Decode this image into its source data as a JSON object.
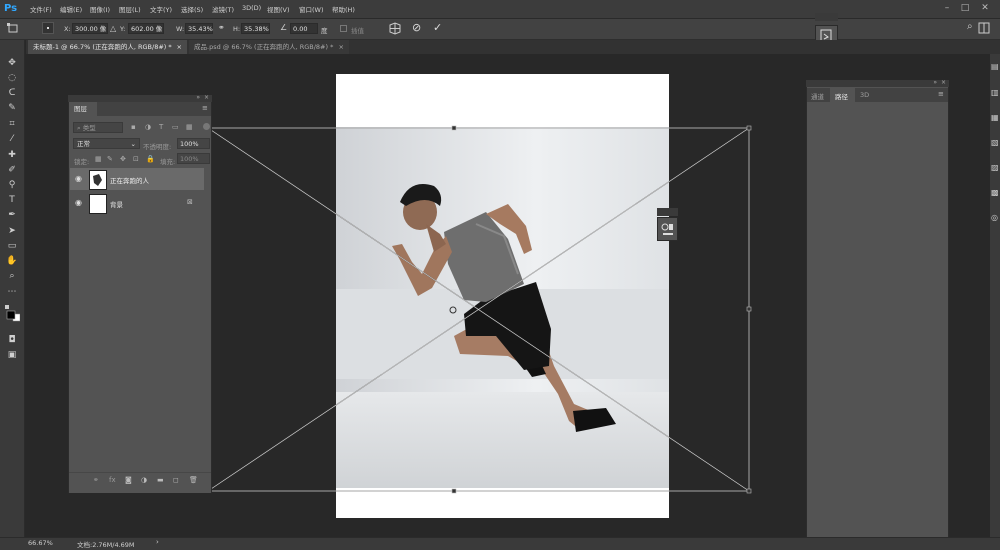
{
  "app": {
    "logo": "Ps"
  },
  "menu": [
    "文件(F)",
    "编辑(E)",
    "图像(I)",
    "图层(L)",
    "文字(Y)",
    "选择(S)",
    "滤镜(T)",
    "3D(D)",
    "视图(V)",
    "窗口(W)",
    "帮助(H)"
  ],
  "window_controls": {
    "minimize": "–",
    "maximize": "□",
    "close": "✕"
  },
  "options": {
    "x_label": "X:",
    "x_value": "300.00 像",
    "y_label": "Y:",
    "y_value": "602.00 像",
    "w_label": "W:",
    "w_value": "35.43%",
    "h_label": "H:",
    "h_value": "35.38%",
    "angle_value": "0.00",
    "angle_unit": "度",
    "interp_label": "插值",
    "warp_label": "操控变形",
    "cancel": "⊘",
    "commit": "✓"
  },
  "tabs": [
    {
      "label": "未标题-1 @ 66.7% (正在奔跑的人, RGB/8#) *",
      "close": "×"
    },
    {
      "label": "成品.psd @ 66.7% (正在奔跑的人, RGB/8#) *",
      "close": "×"
    }
  ],
  "layers_panel": {
    "title": "图层",
    "kind_placeholder": "类型",
    "blend_mode": "正常",
    "opacity_label": "不透明度:",
    "opacity_value": "100%",
    "lock_label": "锁定:",
    "fill_label": "填充:",
    "fill_value": "100%",
    "layers": [
      {
        "name": "正在奔跑的人",
        "selected": true,
        "locked": false
      },
      {
        "name": "背景",
        "selected": false,
        "locked": true
      }
    ]
  },
  "paths_panel": {
    "tabs": [
      "通道",
      "路径",
      "3D"
    ],
    "active_tab": "路径"
  },
  "status": {
    "zoom": "66.67%",
    "doc_info": "文档:2.76M/4.69M"
  },
  "colors": {
    "ps_blue": "#31a8ff",
    "panel_bg": "#535353",
    "workspace": "#282828"
  }
}
